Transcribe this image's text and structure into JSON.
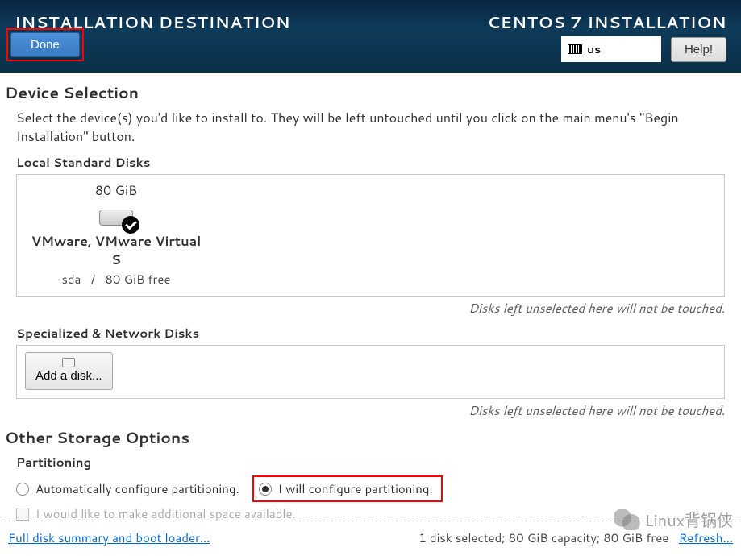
{
  "header": {
    "title": "INSTALLATION DESTINATION",
    "product_title": "CENTOS 7 INSTALLATION",
    "done_label": "Done",
    "help_label": "Help!",
    "keyboard_layout": "us"
  },
  "device_selection": {
    "heading": "Device Selection",
    "description": "Select the device(s) you'd like to install to.  They will be left untouched until you click on the main menu's \"Begin Installation\" button.",
    "local_disks_heading": "Local Standard Disks",
    "disks": [
      {
        "size": "80 GiB",
        "name": "VMware, VMware Virtual S",
        "device": "sda",
        "separator": "/",
        "free": "80 GiB free",
        "selected": true
      }
    ],
    "unselected_note": "Disks left unselected here will not be touched.",
    "network_disks_heading": "Specialized & Network Disks",
    "add_disk_label": "Add a disk..."
  },
  "storage_options": {
    "heading": "Other Storage Options",
    "partitioning_label": "Partitioning",
    "auto_label": "Automatically configure partitioning.",
    "manual_label": "I will configure partitioning.",
    "selected": "manual",
    "additional_space_label": "I would like to make additional space available.",
    "additional_space_enabled": false
  },
  "footer": {
    "summary_link": "Full disk summary and boot loader...",
    "status": "1 disk selected; 80 GiB capacity; 80 GiB free",
    "refresh_link": "Refresh..."
  },
  "watermark": {
    "text": "Linux背锅侠"
  }
}
